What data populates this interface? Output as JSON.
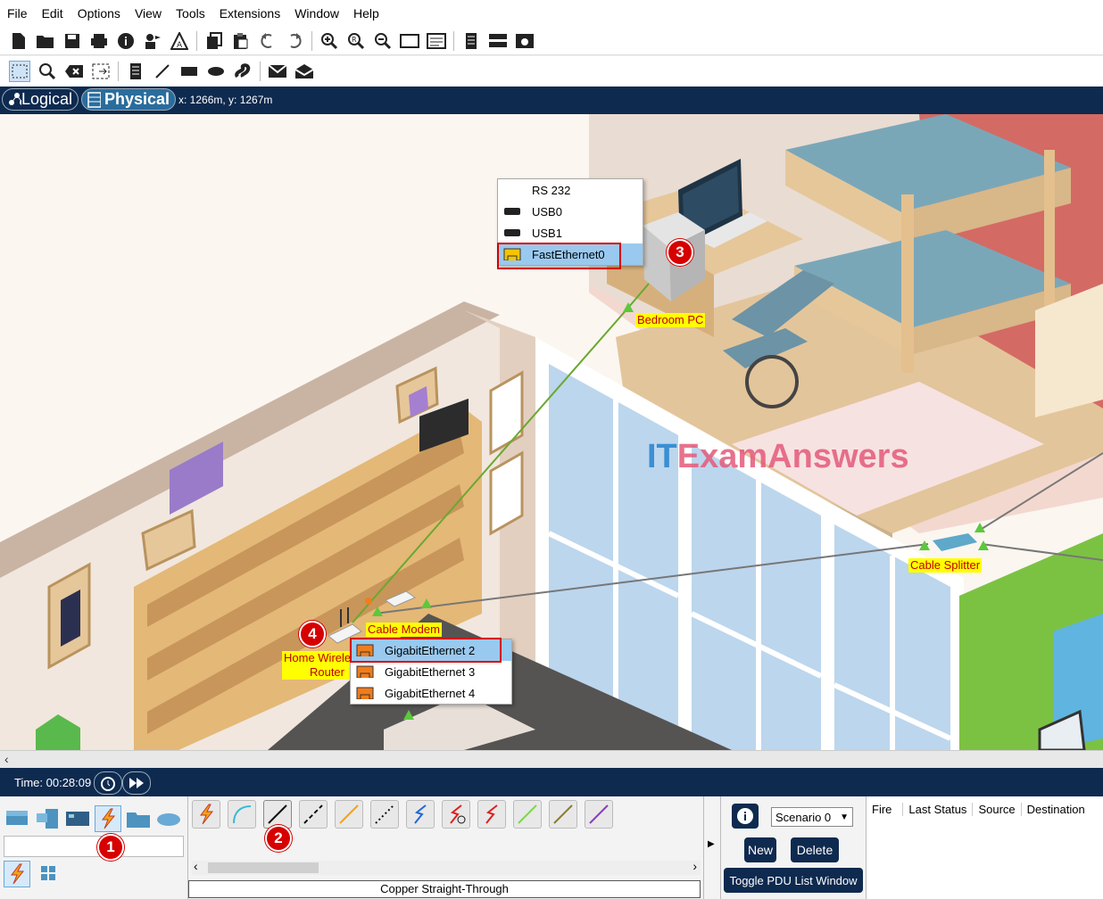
{
  "menu": [
    "File",
    "Edit",
    "Options",
    "View",
    "Tools",
    "Extensions",
    "Window",
    "Help"
  ],
  "modes": {
    "logical": "Logical",
    "physical": "Physical",
    "coords": "x: 1266m, y: 1267m"
  },
  "devices": {
    "bedroom_pc": "Bedroom PC",
    "cable_splitter": "Cable Splitter",
    "cable_modem": "Cable Modem",
    "router_line1": "Home Wirele",
    "router_line2": "Router"
  },
  "pc_ports": [
    "RS 232",
    "USB0",
    "USB1",
    "FastEthernet0"
  ],
  "router_ports": [
    "GigabitEthernet 2",
    "GigabitEthernet 3",
    "GigabitEthernet 4"
  ],
  "badges": [
    "1",
    "2",
    "3",
    "4"
  ],
  "watermark": {
    "it": "IT",
    "rest": "ExamAnswers"
  },
  "time": {
    "label": "Time: 00:28:09"
  },
  "connection_label": "Copper Straight-Through",
  "scenario": {
    "selected": "Scenario 0",
    "new": "New",
    "delete": "Delete",
    "toggle": "Toggle PDU List Window"
  },
  "pdu_columns": [
    "Fire",
    "Last Status",
    "Source",
    "Destination"
  ],
  "colors": {
    "nav": "#0e2a4f",
    "label_bg": "#ffff00",
    "label_text": "#c00000",
    "highlight": "#d60000",
    "selection": "#99c9ef",
    "link": "#6aa830"
  }
}
